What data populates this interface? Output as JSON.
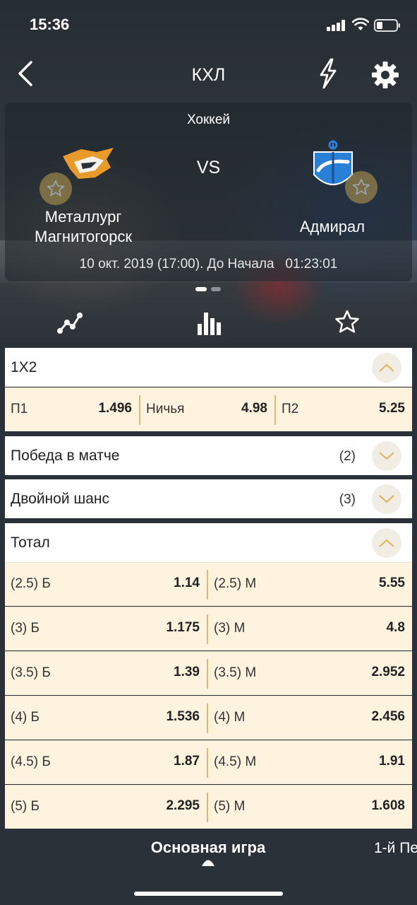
{
  "status_bar": {
    "time": "15:36"
  },
  "nav": {
    "title": "КХЛ"
  },
  "match": {
    "sport": "Хоккей",
    "vs": "VS",
    "team1": "Металлург Магнитогорск",
    "team2": "Адмирал",
    "datetime": "10 окт. 2019 (17:00). До Начала   01:23:01"
  },
  "markets": {
    "m1x2": {
      "title": "1X2",
      "odds": [
        {
          "label": "П1",
          "value": "1.496"
        },
        {
          "label": "Ничья",
          "value": "4.98"
        },
        {
          "label": "П2",
          "value": "5.25"
        }
      ]
    },
    "win": {
      "title": "Победа в матче",
      "count": "(2)"
    },
    "double": {
      "title": "Двойной шанс",
      "count": "(3)"
    },
    "total": {
      "title": "Тотал",
      "rows": [
        {
          "over_label": "(2.5) Б",
          "over": "1.14",
          "under_label": "(2.5) М",
          "under": "5.55"
        },
        {
          "over_label": "(3) Б",
          "over": "1.175",
          "under_label": "(3) М",
          "under": "4.8"
        },
        {
          "over_label": "(3.5) Б",
          "over": "1.39",
          "under_label": "(3.5) М",
          "under": "2.952"
        },
        {
          "over_label": "(4) Б",
          "over": "1.536",
          "under_label": "(4) М",
          "under": "2.456"
        },
        {
          "over_label": "(4.5) Б",
          "over": "1.87",
          "under_label": "(4.5) М",
          "under": "1.91"
        },
        {
          "over_label": "(5) Б",
          "over": "2.295",
          "under_label": "(5) М",
          "under": "1.608"
        }
      ]
    }
  },
  "tabs": {
    "main": "Основная игра",
    "next": "1-й Пе"
  },
  "colors": {
    "accent": "#e0b35a",
    "odds_bg": "#fdf3df",
    "background": "#2a3138"
  }
}
